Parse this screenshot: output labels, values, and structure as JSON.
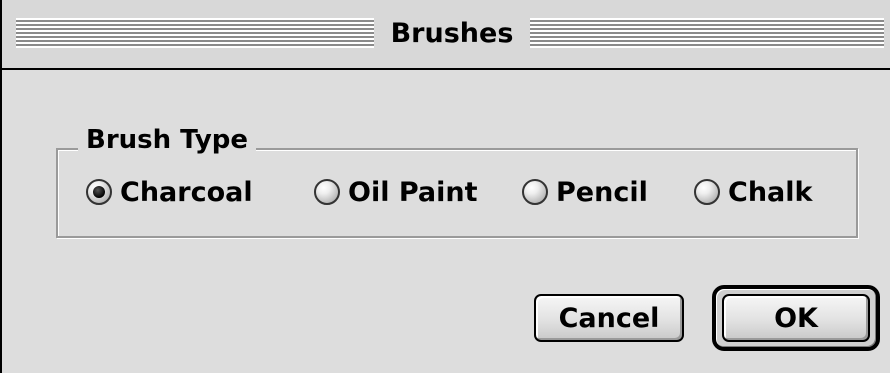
{
  "window": {
    "title": "Brushes"
  },
  "brush_type": {
    "label": "Brush Type",
    "options": [
      {
        "label": "Charcoal",
        "selected": true
      },
      {
        "label": "Oil Paint",
        "selected": false
      },
      {
        "label": "Pencil",
        "selected": false
      },
      {
        "label": "Chalk",
        "selected": false
      }
    ]
  },
  "buttons": {
    "cancel_label": "Cancel",
    "ok_label": "OK",
    "default": "ok"
  },
  "icons": {
    "radio_selected": "radio-selected-icon",
    "radio_unselected": "radio-unselected-icon"
  },
  "colors": {
    "window_bg": "#dddddd",
    "border": "#000000",
    "group_border": "#9a9a9a"
  }
}
